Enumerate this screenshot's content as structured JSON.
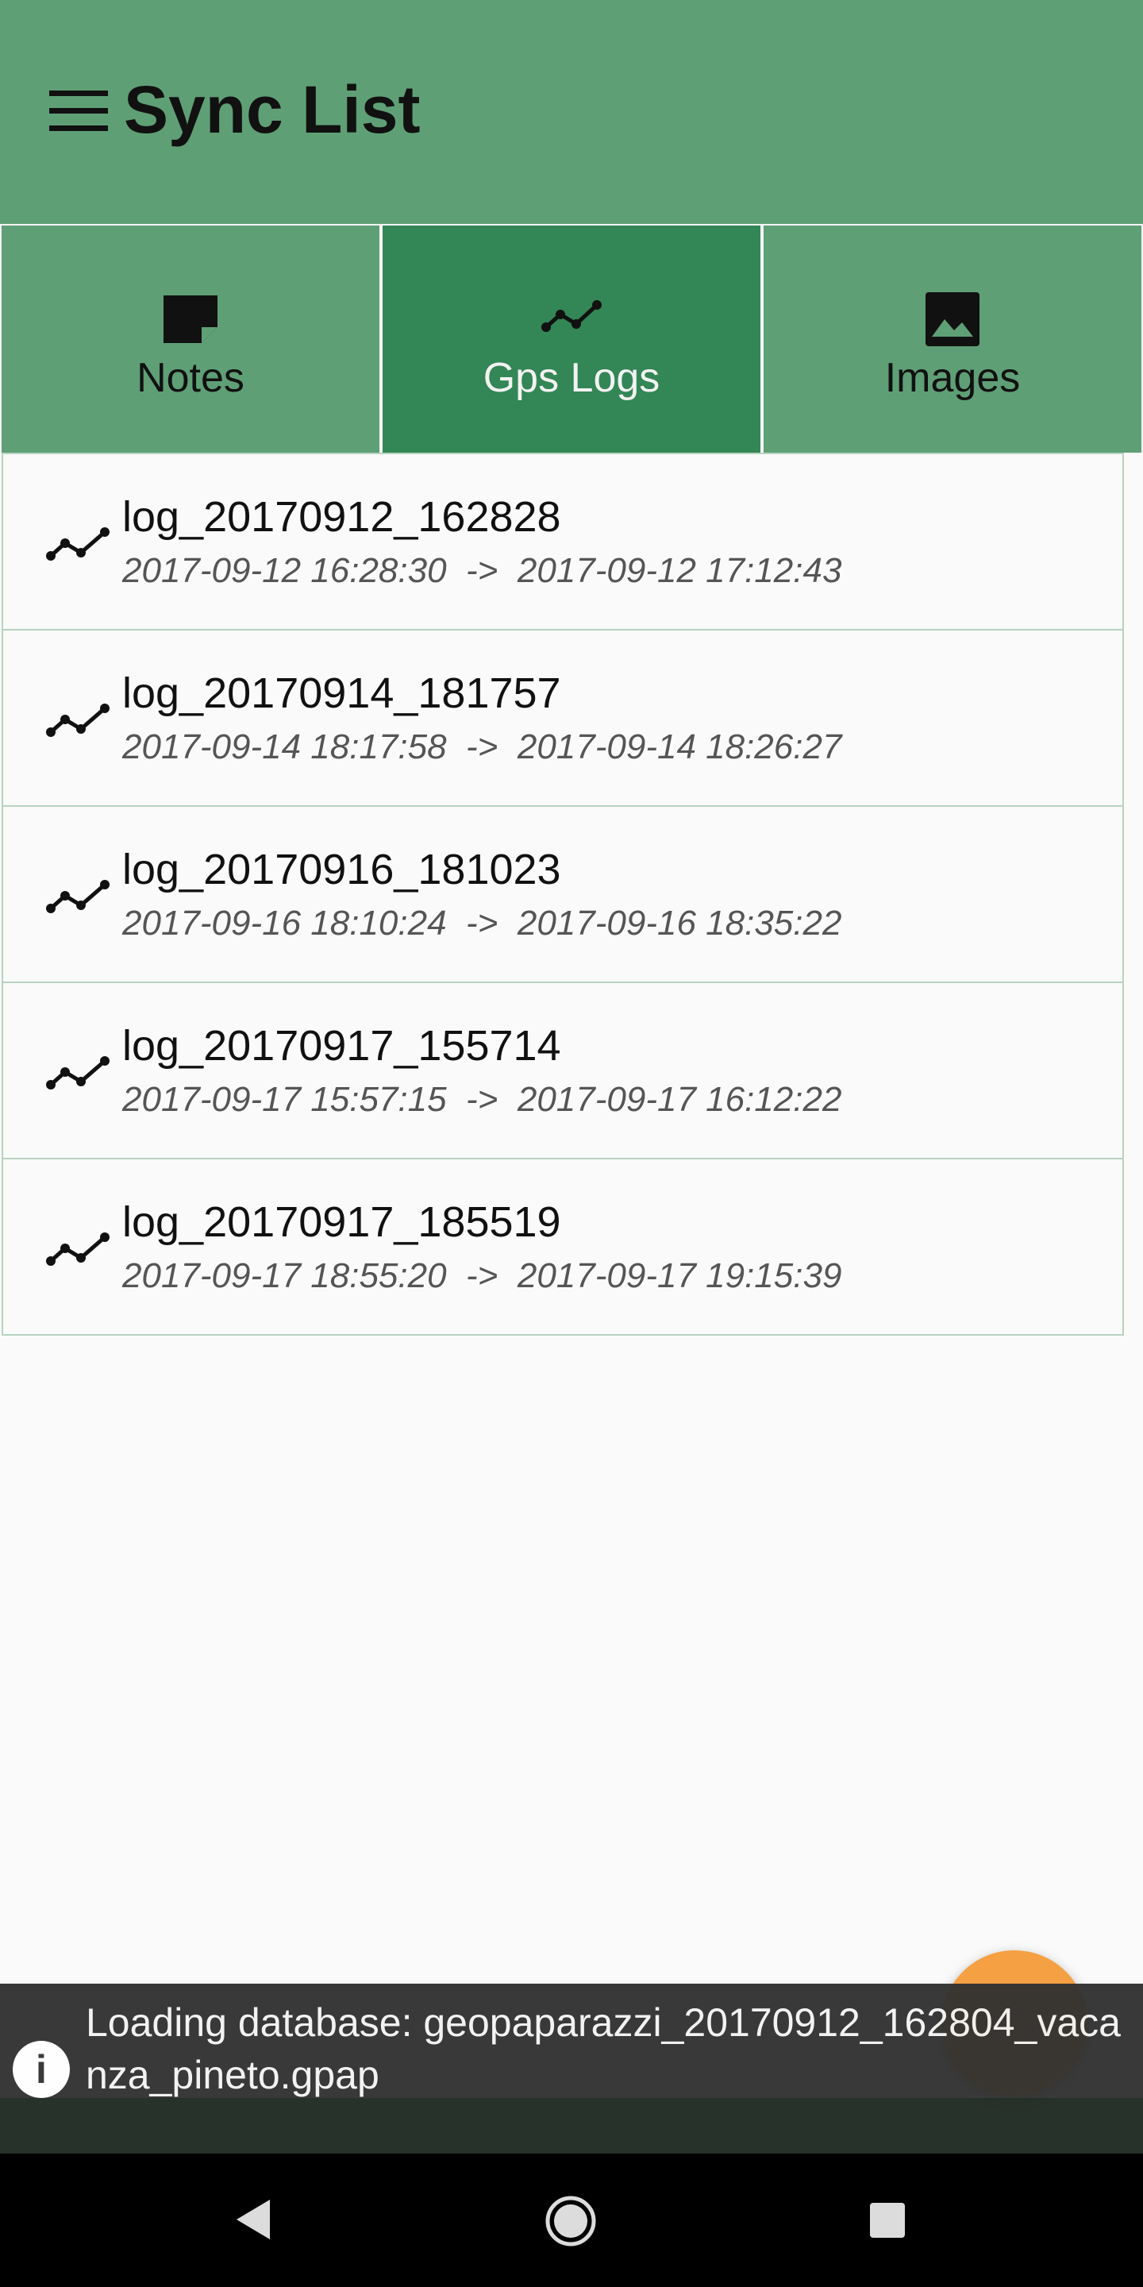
{
  "appbar": {
    "title": "Sync List",
    "menu_icon": "menu-icon"
  },
  "tabs": [
    {
      "label": "Notes",
      "icon": "note-icon",
      "active": false
    },
    {
      "label": "Gps Logs",
      "icon": "timeline-icon",
      "active": true
    },
    {
      "label": "Images",
      "icon": "image-icon",
      "active": false
    }
  ],
  "logs": [
    {
      "name": "log_20170912_162828",
      "start": "2017-09-12 16:28:30",
      "end": "2017-09-12 17:12:43"
    },
    {
      "name": "log_20170914_181757",
      "start": "2017-09-14 18:17:58",
      "end": "2017-09-14 18:26:27"
    },
    {
      "name": "log_20170916_181023",
      "start": "2017-09-16 18:10:24",
      "end": "2017-09-16 18:35:22"
    },
    {
      "name": "log_20170917_155714",
      "start": "2017-09-17 15:57:15",
      "end": "2017-09-17 16:12:22"
    },
    {
      "name": "log_20170917_185519",
      "start": "2017-09-17 18:55:20",
      "end": "2017-09-17 19:15:39"
    }
  ],
  "date_separator": "->",
  "fab": {
    "icon": "cloud-upload-icon",
    "color": "#f4a043"
  },
  "snackbar": {
    "icon": "info-icon",
    "text": "Loading database: geopaparazzi_20170912_162804_vacanza_pineto.gpap"
  },
  "navbar": {
    "back": "back-icon",
    "home": "home-icon",
    "recents": "recents-icon"
  },
  "colors": {
    "appbar": "#5f9f76",
    "active_tab": "#338655",
    "row_border": "#b7d3bf"
  }
}
